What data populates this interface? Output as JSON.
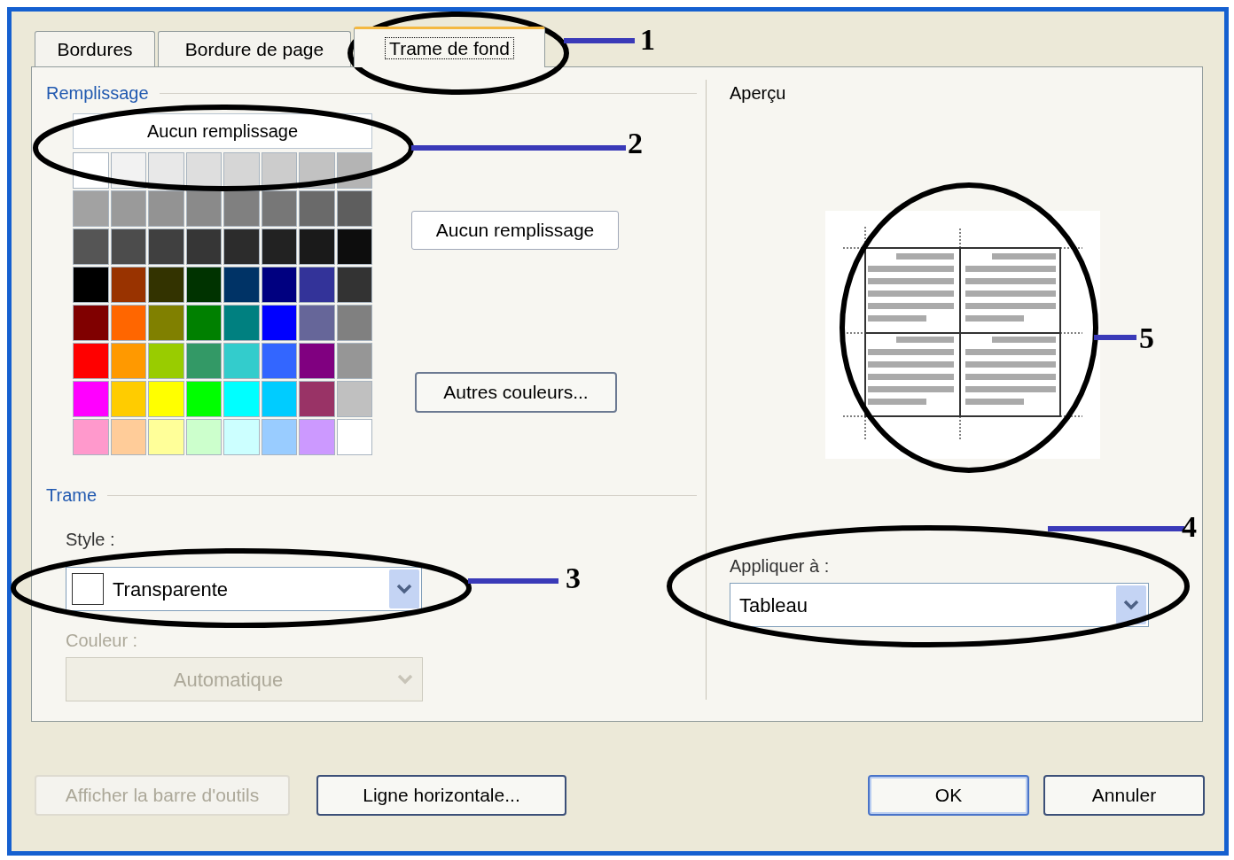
{
  "tabs": [
    {
      "label": "Bordures",
      "selected": false
    },
    {
      "label": "Bordure de page",
      "selected": false
    },
    {
      "label": "Trame de fond",
      "selected": true
    }
  ],
  "fill": {
    "title": "Remplissage",
    "palette_no_fill": "Aucun remplissage",
    "swatches": [
      {
        "color": "#ffffff"
      },
      {
        "color": "#f2f2f2"
      },
      {
        "color": "#e8e8e8"
      },
      {
        "color": "#dedede"
      },
      {
        "color": "#d6d6d6"
      },
      {
        "color": "#cccccc"
      },
      {
        "color": "#c2c2c2"
      },
      {
        "color": "#b4b4b4"
      },
      {
        "color": "#a2a2a2"
      },
      {
        "color": "#9a9a9a"
      },
      {
        "color": "#939393"
      },
      {
        "color": "#8a8a8a"
      },
      {
        "color": "#808080"
      },
      {
        "color": "#777777"
      },
      {
        "color": "#6a6a6a"
      },
      {
        "color": "#5e5e5e"
      },
      {
        "color": "#555555"
      },
      {
        "color": "#4c4c4c"
      },
      {
        "color": "#404040"
      },
      {
        "color": "#363636"
      },
      {
        "color": "#2c2c2c"
      },
      {
        "color": "#222222"
      },
      {
        "color": "#1a1a1a"
      },
      {
        "color": "#0d0d0d"
      },
      {
        "color": "#000000"
      },
      {
        "color": "#993300"
      },
      {
        "color": "#333300"
      },
      {
        "color": "#003300"
      },
      {
        "color": "#003366"
      },
      {
        "color": "#000080"
      },
      {
        "color": "#333399"
      },
      {
        "color": "#333333"
      },
      {
        "color": "#800000"
      },
      {
        "color": "#ff6600"
      },
      {
        "color": "#808000"
      },
      {
        "color": "#008000"
      },
      {
        "color": "#008080"
      },
      {
        "color": "#0000ff"
      },
      {
        "color": "#666699"
      },
      {
        "color": "#808080"
      },
      {
        "color": "#ff0000"
      },
      {
        "color": "#ff9900"
      },
      {
        "color": "#99cc00"
      },
      {
        "color": "#339966"
      },
      {
        "color": "#33cccc"
      },
      {
        "color": "#3366ff"
      },
      {
        "color": "#800080"
      },
      {
        "color": "#969696"
      },
      {
        "color": "#ff00ff"
      },
      {
        "color": "#ffcc00"
      },
      {
        "color": "#ffff00"
      },
      {
        "color": "#00ff00"
      },
      {
        "color": "#00ffff"
      },
      {
        "color": "#00ccff"
      },
      {
        "color": "#993366"
      },
      {
        "color": "#c0c0c0"
      },
      {
        "color": "#ff99cc"
      },
      {
        "color": "#ffcc99"
      },
      {
        "color": "#ffff99"
      },
      {
        "color": "#ccffcc"
      },
      {
        "color": "#ccffff"
      },
      {
        "color": "#99ccff"
      },
      {
        "color": "#cc99ff"
      },
      {
        "color": "#ffffff"
      }
    ],
    "no_fill_button": "Aucun remplissage",
    "more_colors_button": "Autres couleurs..."
  },
  "pattern": {
    "title": "Trame",
    "style": {
      "label": "Style :",
      "value": "Transparente",
      "disabled": false
    },
    "color": {
      "label": "Couleur :",
      "value": "Automatique",
      "disabled": true
    }
  },
  "preview": {
    "title": "Aperçu",
    "apply_to": {
      "label": "Appliquer à :",
      "value": "Tableau",
      "disabled": false
    }
  },
  "buttons": [
    {
      "label": "Afficher la barre d'outils",
      "disabled": true,
      "default": false
    },
    {
      "label": "Ligne horizontale...",
      "disabled": false,
      "default": false
    },
    {
      "label": "OK",
      "disabled": false,
      "default": true
    },
    {
      "label": "Annuler",
      "disabled": false,
      "default": false
    }
  ],
  "annotations": [
    {
      "number": "1"
    },
    {
      "number": "2"
    },
    {
      "number": "3"
    },
    {
      "number": "4"
    },
    {
      "number": "5"
    }
  ]
}
